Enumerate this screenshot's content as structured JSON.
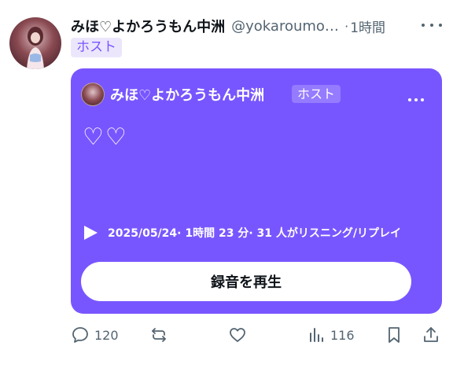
{
  "post": {
    "author_name": "みほ♡よかろうもん中洲",
    "handle": "@yokaroumon_nakasu",
    "separator": "·",
    "time": "1時間",
    "badge": "ホスト"
  },
  "card": {
    "host_name": "みほ♡よかろうもん中洲",
    "badge": "ホスト",
    "title": "♡♡",
    "meta": "2025/05/24· 1時間 23 分· 31 人がリスニング/リプレイ",
    "play_button_label": "録音を再生",
    "background_color": "#7856ff"
  },
  "actions": {
    "reply_count": "120",
    "views_count": "116",
    "icons": [
      "reply-icon",
      "repost-icon",
      "like-icon",
      "views-icon",
      "bookmark-icon",
      "share-icon"
    ]
  },
  "colors": {
    "accent": "#7856ff",
    "muted": "#536471",
    "text": "#0f1419"
  }
}
